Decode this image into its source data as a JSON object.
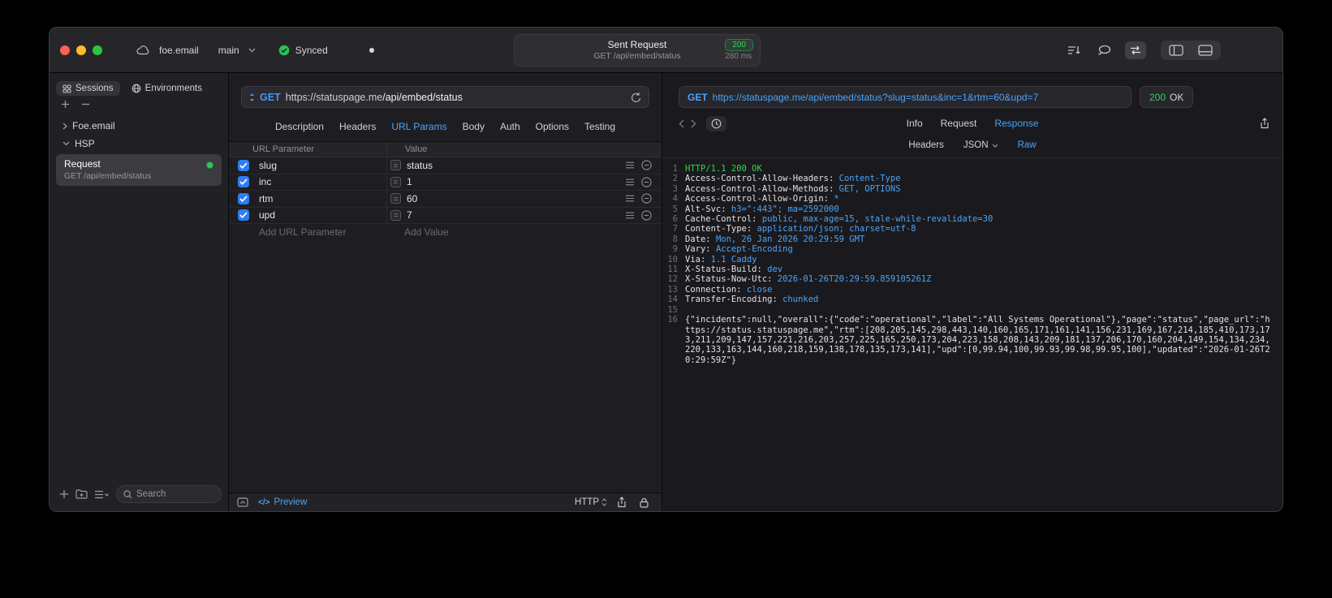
{
  "colors": {
    "accent_blue": "#4da3f8",
    "success_green": "#32d74b",
    "checkbox_blue": "#2e7cf6"
  },
  "titlebar": {
    "project": "foe.email",
    "branch": "main",
    "sync_label": "Synced",
    "summary": {
      "title": "Sent Request",
      "status_code": "200",
      "request_line": "GET /api/embed/status",
      "duration": "280 ms"
    }
  },
  "sidebar": {
    "tabs": [
      "Sessions",
      "Environments"
    ],
    "tree": [
      {
        "label": "Foe.email",
        "expanded": false
      },
      {
        "label": "HSP",
        "expanded": true
      }
    ],
    "request_item": {
      "title": "Request",
      "subtitle": "GET /api/embed/status"
    },
    "search_placeholder": "Search"
  },
  "request_panel": {
    "method": "GET",
    "url_host": "https://statuspage.me",
    "url_path": "/api/embed/status",
    "tabs": [
      "Description",
      "Headers",
      "URL Params",
      "Body",
      "Auth",
      "Options",
      "Testing"
    ],
    "active_tab": "URL Params",
    "params_table": {
      "columns": [
        "URL Parameter",
        "Value"
      ],
      "equals_glyph": "=",
      "rows": [
        {
          "name": "slug",
          "value": "status",
          "checked": true
        },
        {
          "name": "inc",
          "value": "1",
          "checked": true
        },
        {
          "name": "rtm",
          "value": "60",
          "checked": true
        },
        {
          "name": "upd",
          "value": "7",
          "checked": true
        }
      ],
      "add_name_placeholder": "Add URL Parameter",
      "add_value_placeholder": "Add Value"
    },
    "footer": {
      "code_glyph": "</>",
      "preview_label": "Preview",
      "protocol_label": "HTTP"
    }
  },
  "response_panel": {
    "method": "GET",
    "url": "https://statuspage.me/api/embed/status?slug=status&inc=1&rtm=60&upd=7",
    "status_code": "200",
    "status_text": "OK",
    "tabs": [
      "Info",
      "Request",
      "Response"
    ],
    "active_tab": "Response",
    "subtabs": [
      "Headers",
      "JSON",
      "Raw"
    ],
    "active_subtab": "Raw",
    "lines": [
      {
        "num": "1",
        "green": "HTTP/1.1 200 OK"
      },
      {
        "num": "2",
        "plain": "Access-Control-Allow-Headers: ",
        "blue": "Content-Type"
      },
      {
        "num": "3",
        "plain": "Access-Control-Allow-Methods: ",
        "blue": "GET, OPTIONS"
      },
      {
        "num": "4",
        "plain": "Access-Control-Allow-Origin: ",
        "blue": "*"
      },
      {
        "num": "5",
        "plain": "Alt-Svc: ",
        "blue": "h3=\":443\"; ma=2592000"
      },
      {
        "num": "6",
        "plain": "Cache-Control: ",
        "blue": "public, max-age=15, stale-while-revalidate=30"
      },
      {
        "num": "7",
        "plain": "Content-Type: ",
        "blue": "application/json; charset=utf-8"
      },
      {
        "num": "8",
        "plain": "Date: ",
        "blue": "Mon, 26 Jan 2026 20:29:59 GMT"
      },
      {
        "num": "9",
        "plain": "Vary: ",
        "blue": "Accept-Encoding"
      },
      {
        "num": "10",
        "plain": "Via: ",
        "blue": "1.1 Caddy"
      },
      {
        "num": "11",
        "plain": "X-Status-Build: ",
        "blue": "dev"
      },
      {
        "num": "12",
        "plain": "X-Status-Now-Utc: ",
        "blue": "2026-01-26T20:29:59.859105261Z"
      },
      {
        "num": "13",
        "plain": "Connection: ",
        "blue": "close"
      },
      {
        "num": "14",
        "plain": "Transfer-Encoding: ",
        "blue": "chunked"
      },
      {
        "num": "15"
      },
      {
        "num": "16",
        "plain": "{\"incidents\":null,\"overall\":{\"code\":\"operational\",\"label\":\"All Systems Operational\"},\"page\":\"status\",\"page_url\":\"https://status.statuspage.me\",\"rtm\":[208,205,145,298,443,140,160,165,171,161,141,156,231,169,167,214,185,410,173,173,211,209,147,157,221,216,203,257,225,165,250,173,204,223,158,208,143,209,181,137,206,170,160,204,149,154,134,234,220,133,163,144,160,218,159,138,178,135,173,141],\"upd\":[0,99.94,100,99.93,99.98,99.95,100],\"updated\":\"2026-01-26T20:29:59Z\"}"
      }
    ]
  }
}
